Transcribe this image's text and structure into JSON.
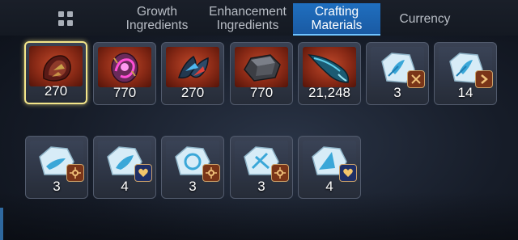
{
  "tabs": [
    {
      "label_line1": "Growth",
      "label_line2": "Ingredients",
      "active": false
    },
    {
      "label_line1": "Enhancement",
      "label_line2": "Ingredients",
      "active": false
    },
    {
      "label_line1": "Crafting",
      "label_line2": "Materials",
      "active": true
    },
    {
      "label_line1": "Currency",
      "label_line2": "",
      "active": false
    }
  ],
  "items_row1": [
    {
      "icon": "dragon-scale-icon",
      "quantity": "270",
      "selected": true
    },
    {
      "icon": "magic-orb-icon",
      "quantity": "770"
    },
    {
      "icon": "winged-crest-icon",
      "quantity": "270"
    },
    {
      "icon": "iron-ore-icon",
      "quantity": "770"
    },
    {
      "icon": "blue-feather-icon",
      "quantity": "21,248"
    },
    {
      "icon": "ice-crystal-icon",
      "quantity": "3",
      "badge": "crossed-spears-badge"
    },
    {
      "icon": "ice-crystal-icon",
      "quantity": "14",
      "badge": "arrow-badge"
    }
  ],
  "items_row2": [
    {
      "icon": "ice-crystal-icon",
      "quantity": "3",
      "badge": "sun-badge"
    },
    {
      "icon": "ice-crystal-icon",
      "quantity": "4",
      "badge": "heart-badge"
    },
    {
      "icon": "ice-crystal-icon",
      "quantity": "3",
      "badge": "sun-badge"
    },
    {
      "icon": "ice-crystal-icon",
      "quantity": "3",
      "badge": "sun-badge"
    },
    {
      "icon": "ice-crystal-icon",
      "quantity": "4",
      "badge": "heart-badge"
    }
  ],
  "colors": {
    "accent_tab": "#1f6fbf",
    "selected_border": "#f3e58a",
    "slot_bg": "#30374a"
  }
}
